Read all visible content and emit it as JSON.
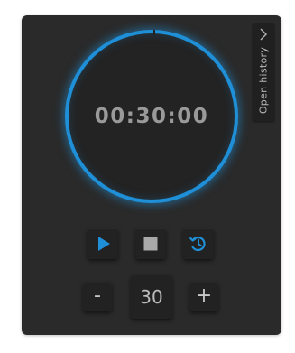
{
  "timer": {
    "display": "00:30:00"
  },
  "history": {
    "label": "Open history",
    "icon": "chevron-right-icon"
  },
  "controls": {
    "play_icon": "play-icon",
    "stop_icon": "stop-icon",
    "reset_icon": "history-reset-icon"
  },
  "duration": {
    "decrement_label": "-",
    "value": "30",
    "increment_label": "+"
  },
  "colors": {
    "accent": "#1f8fd8",
    "panel_background": "#2a2a2a",
    "button_background": "#222222",
    "text": "#9a9a9a"
  }
}
